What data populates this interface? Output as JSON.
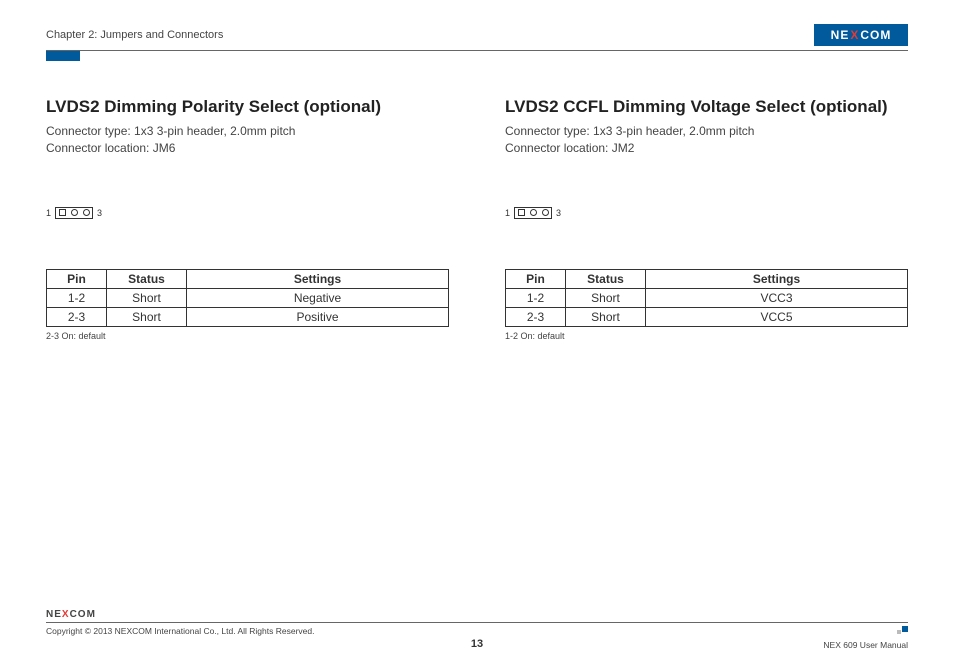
{
  "header": {
    "chapter": "Chapter 2: Jumpers and Connectors",
    "logo": {
      "pre": "NE",
      "x": "X",
      "post": "COM"
    }
  },
  "left": {
    "title": "LVDS2 Dimming Polarity Select (optional)",
    "connector_type": "Connector type: 1x3 3-pin header, 2.0mm pitch",
    "connector_location": "Connector location: JM6",
    "pin_left": "1",
    "pin_right": "3",
    "table": {
      "headers": {
        "pin": "Pin",
        "status": "Status",
        "settings": "Settings"
      },
      "rows": [
        {
          "pin": "1-2",
          "status": "Short",
          "settings": "Negative"
        },
        {
          "pin": "2-3",
          "status": "Short",
          "settings": "Positive"
        }
      ]
    },
    "note": "2-3 On: default"
  },
  "right": {
    "title": "LVDS2 CCFL Dimming Voltage Select (optional)",
    "connector_type": "Connector type: 1x3 3-pin header, 2.0mm pitch",
    "connector_location": "Connector location: JM2",
    "pin_left": "1",
    "pin_right": "3",
    "table": {
      "headers": {
        "pin": "Pin",
        "status": "Status",
        "settings": "Settings"
      },
      "rows": [
        {
          "pin": "1-2",
          "status": "Short",
          "settings": "VCC3"
        },
        {
          "pin": "2-3",
          "status": "Short",
          "settings": "VCC5"
        }
      ]
    },
    "note": "1-2 On: default"
  },
  "footer": {
    "logo": {
      "pre": "NE",
      "x": "X",
      "post": "COM"
    },
    "copyright": "Copyright © 2013 NEXCOM International Co., Ltd. All Rights Reserved.",
    "page_number": "13",
    "manual": "NEX 609 User Manual"
  }
}
